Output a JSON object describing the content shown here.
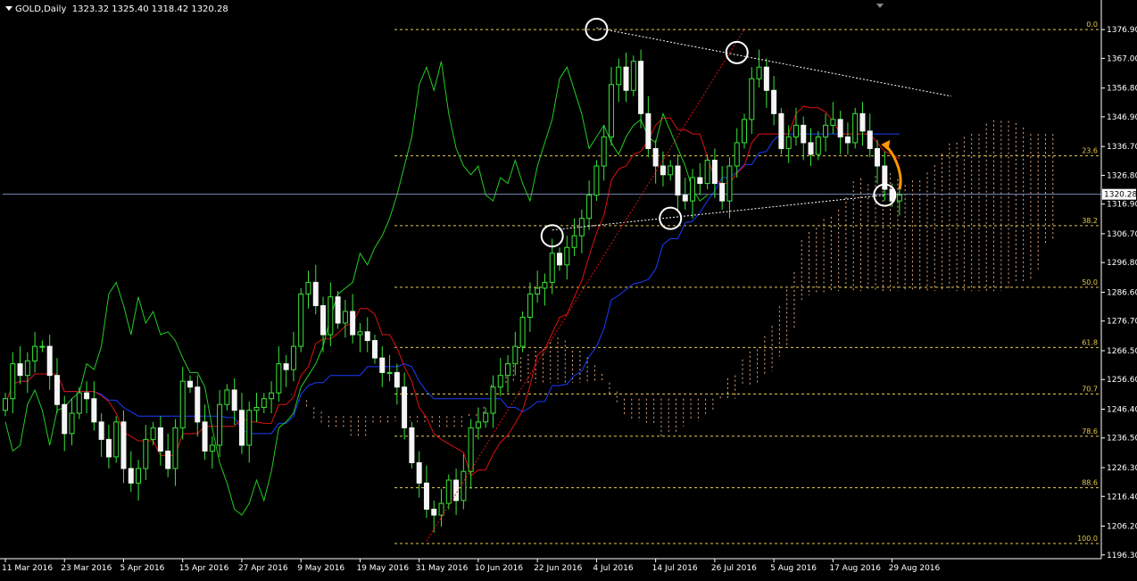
{
  "header": {
    "symbol": "GOLD,Daily",
    "ohlc": "1323.32 1325.40 1318.42 1320.28"
  },
  "chart_data": {
    "type": "candlestick",
    "symbol": "GOLD",
    "timeframe": "Daily",
    "y_axis": {
      "ticks": [
        1376.9,
        1367.0,
        1356.8,
        1346.9,
        1336.7,
        1326.8,
        1316.9,
        1306.7,
        1296.8,
        1286.6,
        1276.7,
        1266.5,
        1256.6,
        1246.4,
        1236.5,
        1226.3,
        1216.4,
        1206.2,
        1196.3
      ],
      "ylim": [
        1195.0,
        1384.0
      ],
      "current_price": 1320.28
    },
    "x_axis": {
      "labels": [
        {
          "label": "11 Mar 2016",
          "bar": 0
        },
        {
          "label": "23 Mar 2016",
          "bar": 8
        },
        {
          "label": "5 Apr 2016",
          "bar": 16
        },
        {
          "label": "15 Apr 2016",
          "bar": 24
        },
        {
          "label": "27 Apr 2016",
          "bar": 32
        },
        {
          "label": "9 May 2016",
          "bar": 40
        },
        {
          "label": "19 May 2016",
          "bar": 48
        },
        {
          "label": "31 May 2016",
          "bar": 56
        },
        {
          "label": "10 Jun 2016",
          "bar": 64
        },
        {
          "label": "22 Jun 2016",
          "bar": 72
        },
        {
          "label": "4 Jul 2016",
          "bar": 80
        },
        {
          "label": "14 Jul 2016",
          "bar": 88
        },
        {
          "label": "26 Jul 2016",
          "bar": 96
        },
        {
          "label": "5 Aug 2016",
          "bar": 104
        },
        {
          "label": "17 Aug 2016",
          "bar": 112
        },
        {
          "label": "29 Aug 2016",
          "bar": 120
        }
      ],
      "bar_count": 122
    },
    "fibonacci": {
      "levels": [
        {
          "label": "0.0",
          "price": 1376.9
        },
        {
          "label": "23.6",
          "price": 1333.5
        },
        {
          "label": "38.2",
          "price": 1309.5
        },
        {
          "label": "50.0",
          "price": 1288.3
        },
        {
          "label": "61.8",
          "price": 1267.6
        },
        {
          "label": "70.7",
          "price": 1251.6
        },
        {
          "label": "78.6",
          "price": 1237.1
        },
        {
          "label": "88.6",
          "price": 1219.4
        },
        {
          "label": "100.0",
          "price": 1200.2
        }
      ],
      "color": "#e6c84a"
    },
    "closes": [
      1250,
      1262,
      1258,
      1263,
      1268,
      1268,
      1258,
      1248,
      1238,
      1245,
      1252,
      1250,
      1242,
      1236,
      1230,
      1242,
      1226,
      1221,
      1226,
      1236,
      1240,
      1232,
      1226,
      1240,
      1256,
      1254,
      1242,
      1232,
      1234,
      1248,
      1253,
      1246,
      1234,
      1246,
      1247,
      1250,
      1252,
      1262,
      1260,
      1268,
      1286,
      1290,
      1282,
      1272,
      1285,
      1276,
      1280,
      1272,
      1273,
      1270,
      1264,
      1259,
      1259,
      1254,
      1240,
      1228,
      1221,
      1212,
      1210,
      1214,
      1222,
      1215,
      1225,
      1240,
      1242,
      1245,
      1254,
      1258,
      1262,
      1268,
      1278,
      1286,
      1288,
      1290,
      1300,
      1296,
      1302,
      1306,
      1312,
      1320,
      1330,
      1340,
      1358,
      1364,
      1356,
      1366,
      1348,
      1336,
      1330,
      1327,
      1330,
      1320,
      1318,
      1326,
      1324,
      1332,
      1324,
      1318,
      1330,
      1338,
      1346,
      1360,
      1364,
      1356,
      1348,
      1336,
      1340,
      1344,
      1338,
      1334,
      1340,
      1344,
      1346,
      1340,
      1338,
      1348,
      1342,
      1336,
      1330,
      1322,
      1318,
      1320
    ],
    "series": [
      {
        "name": "Tenkan-sen",
        "color": "#e01010"
      },
      {
        "name": "Kijun-sen",
        "color": "#1a3cff"
      },
      {
        "name": "Chikou span",
        "color": "#22cc22"
      },
      {
        "name": "Kumo",
        "color": "#e8a87c"
      }
    ],
    "trendlines": [
      {
        "from": [
          80,
          1377.5
        ],
        "to": [
          128,
          1354
        ],
        "color": "#ffffff"
      },
      {
        "from": [
          74,
          1308
        ],
        "to": [
          119,
          1320
        ],
        "color": "#ffffff"
      },
      {
        "from": [
          57,
          1201
        ],
        "to": [
          100,
          1377
        ],
        "color": "#e01010"
      }
    ],
    "highlight_circles": [
      {
        "bar": 80,
        "price": 1377
      },
      {
        "bar": 74,
        "price": 1306
      },
      {
        "bar": 90,
        "price": 1312
      },
      {
        "bar": 99,
        "price": 1369
      },
      {
        "bar": 119,
        "price": 1320
      }
    ],
    "arrow": {
      "bar": 121,
      "price": 1322,
      "to_bar": 119,
      "to_price": 1338,
      "color": "#ff9900"
    }
  }
}
